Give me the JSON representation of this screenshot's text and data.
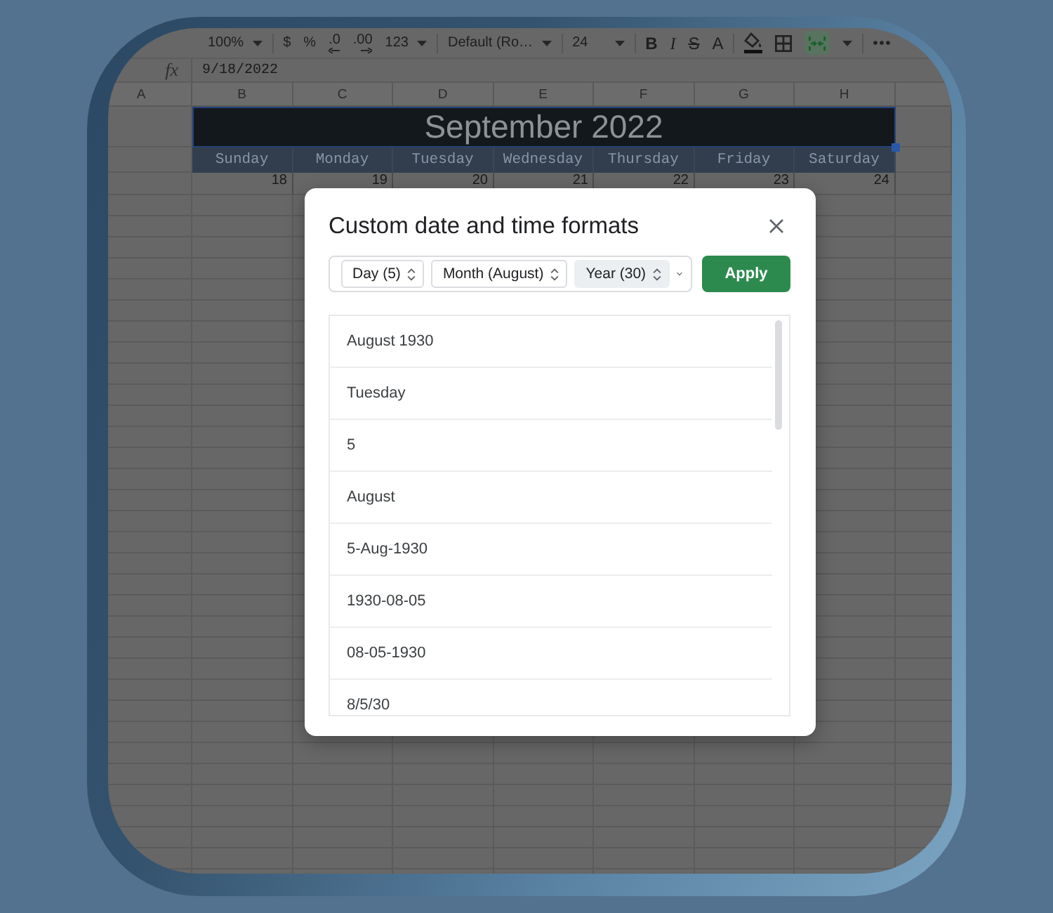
{
  "toolbar": {
    "groups": [
      [
        {
          "kind": "dropdown",
          "label": "100%"
        }
      ],
      [
        {
          "kind": "text",
          "label": "$"
        },
        {
          "kind": "text",
          "label": "%"
        },
        {
          "kind": "decrease",
          "label": ".0"
        },
        {
          "kind": "increase",
          "label": ".00"
        },
        {
          "kind": "dropdown",
          "label": "123"
        }
      ],
      [
        {
          "kind": "dropdown",
          "label": "Default (Ro…"
        }
      ],
      [
        {
          "kind": "field",
          "label": "24"
        }
      ],
      [
        {
          "kind": "bold",
          "label": "B"
        },
        {
          "kind": "italic",
          "label": "I"
        },
        {
          "kind": "strike",
          "label": "S"
        },
        {
          "kind": "color",
          "label": "A"
        }
      ],
      [
        {
          "kind": "fill"
        },
        {
          "kind": "borders"
        },
        {
          "kind": "merge",
          "on": true
        },
        {
          "kind": "caret"
        }
      ],
      [
        {
          "kind": "more"
        }
      ]
    ]
  },
  "formula_bar": {
    "fx": "fx",
    "value": "9/18/2022"
  },
  "sheet": {
    "columns": [
      "A",
      "B",
      "C",
      "D",
      "E",
      "F",
      "G",
      "H"
    ],
    "title": "September 2022",
    "weekdays": [
      "Sunday",
      "Monday",
      "Tuesday",
      "Wednesday",
      "Thursday",
      "Friday",
      "Saturday"
    ],
    "dates": [
      "18",
      "19",
      "20",
      "21",
      "22",
      "23",
      "24"
    ]
  },
  "dialog": {
    "title": "Custom date and time formats",
    "parts": [
      {
        "label": "Day (5)",
        "selected": false
      },
      {
        "label": "Month (August)",
        "selected": false
      },
      {
        "label": "Year (30)",
        "selected": true
      }
    ],
    "apply": "Apply",
    "formats": [
      "August 1930",
      "Tuesday",
      "5",
      "August",
      "5-Aug-1930",
      "1930-08-05",
      "08-05-1930",
      "8/5/30"
    ]
  }
}
